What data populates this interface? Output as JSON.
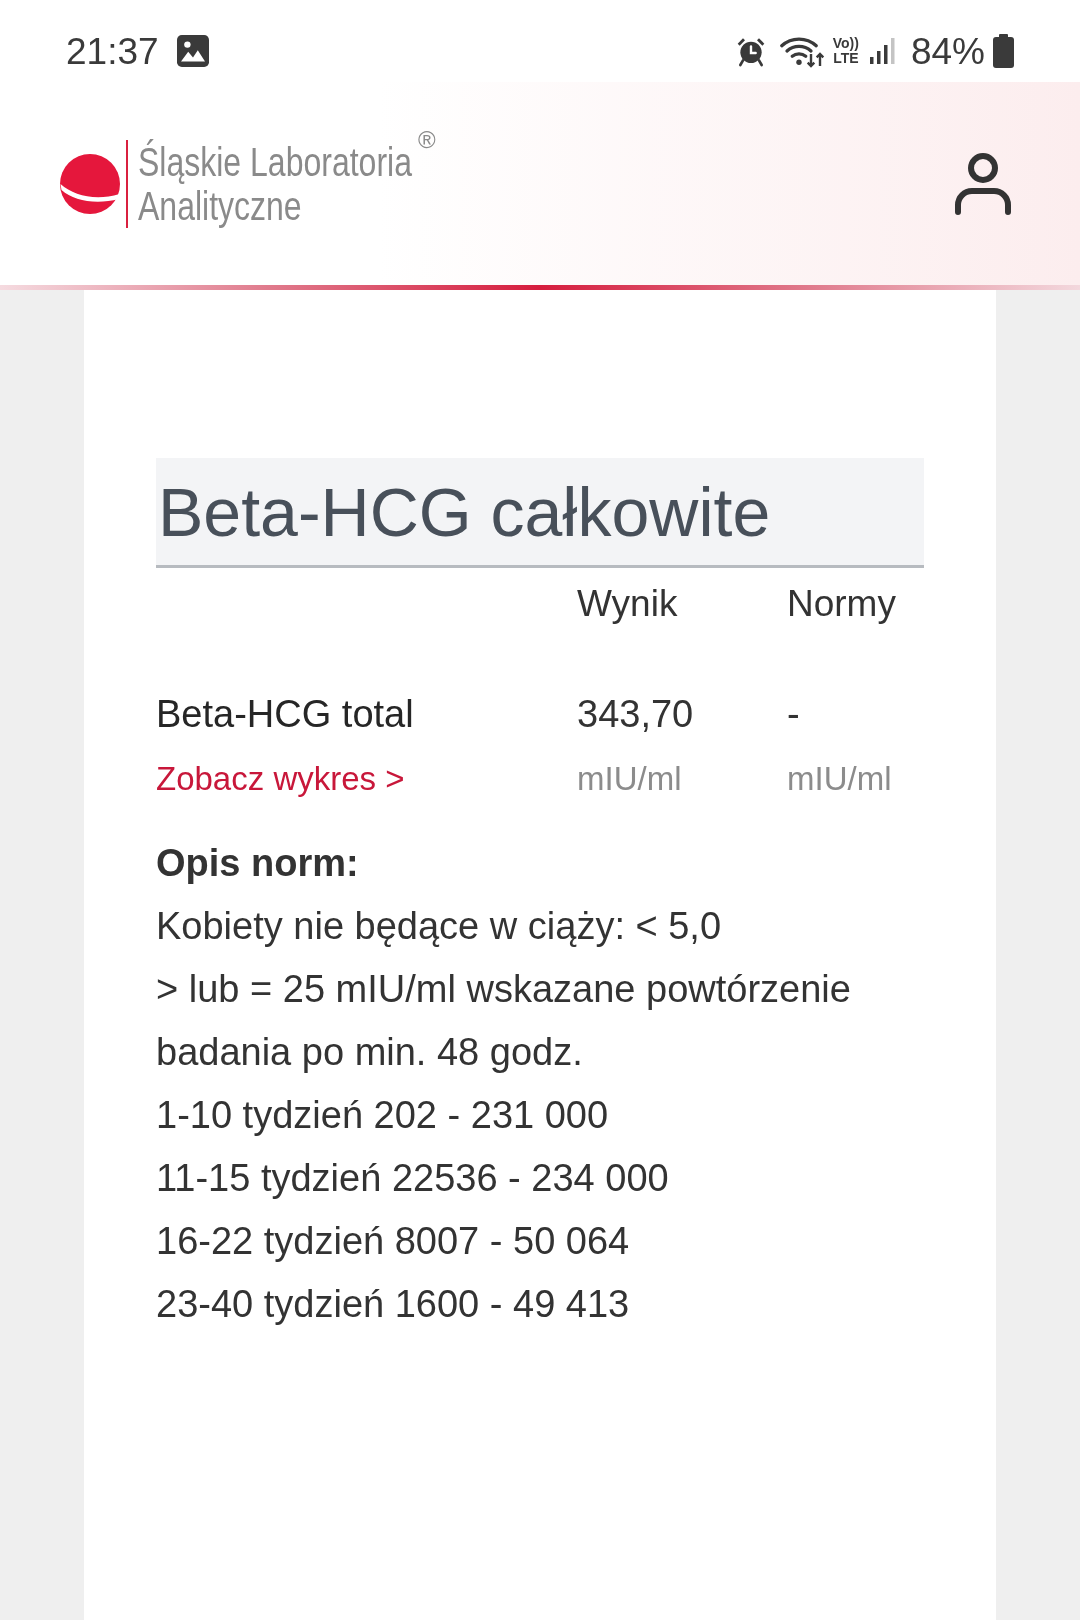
{
  "status_bar": {
    "time": "21:37",
    "voice_label": "Vo))",
    "network_label": "LTE",
    "battery": "84%"
  },
  "header": {
    "brand_line_1": "Śląskie Laboratoria",
    "brand_line_2": "Analityczne",
    "registered_mark": "®"
  },
  "test": {
    "title": "Beta-HCG całkowite",
    "columns": [
      "Wynik",
      "Normy"
    ],
    "rows": [
      {
        "name": "Beta-HCG total",
        "link": "Zobacz wykres >",
        "result": "343,70",
        "result_unit": "mIU/ml",
        "norm": "-",
        "norm_unit": "mIU/ml"
      }
    ]
  },
  "norms": {
    "heading": "Opis norm:",
    "lines": [
      "Kobiety nie będące w ciąży: < 5,0",
      "> lub = 25 mIU/ml wskazane powtórzenie",
      "badania po min. 48 godz.",
      "1-10 tydzień 202 - 231 000",
      "11-15 tydzień 22536 - 234 000",
      "16-22 tydzień 8007 - 50 064",
      "23-40 tydzień 1600 - 49 413"
    ]
  }
}
